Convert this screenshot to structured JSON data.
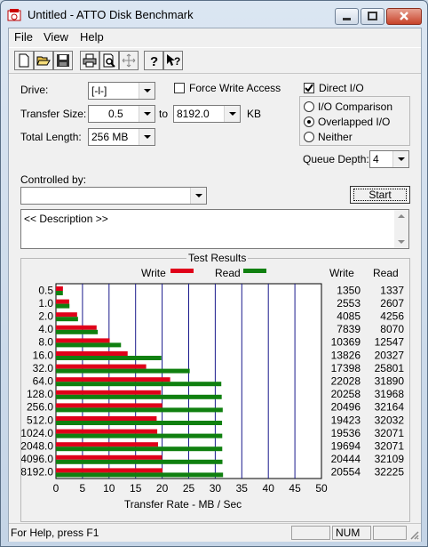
{
  "window": {
    "title": "Untitled - ATTO Disk Benchmark"
  },
  "menu": {
    "file": "File",
    "view": "View",
    "help": "Help"
  },
  "toolbar": {
    "buttons": [
      "new-icon",
      "open-icon",
      "save-icon",
      "print-icon",
      "print-preview-icon",
      "move-icon",
      "help-icon",
      "context-help-icon"
    ]
  },
  "form": {
    "drive_label": "Drive:",
    "drive_value": "[-l-]",
    "force_write_label": "Force Write Access",
    "direct_io_label": "Direct I/O",
    "transfer_size_label": "Transfer Size:",
    "transfer_from": "0.5",
    "to_label": "to",
    "transfer_to": "8192.0",
    "kb_label": "KB",
    "total_length_label": "Total Length:",
    "total_length_value": "256 MB",
    "io_comparison_label": "I/O Comparison",
    "overlapped_io_label": "Overlapped I/O",
    "neither_label": "Neither",
    "queue_depth_label": "Queue Depth:",
    "queue_depth_value": "4",
    "controlled_by_label": "Controlled by:",
    "controlled_by_value": "",
    "start_label": "Start",
    "description": "<< Description >>"
  },
  "results": {
    "group_title": "Test Results",
    "legend_write": "Write",
    "legend_read": "Read",
    "col_write": "Write",
    "col_read": "Read",
    "write_color": "#e0001a",
    "read_color": "#108010",
    "grid_color": "#1a1a8c"
  },
  "chart_data": {
    "type": "bar",
    "orientation": "horizontal",
    "categories": [
      "0.5",
      "1.0",
      "2.0",
      "4.0",
      "8.0",
      "16.0",
      "32.0",
      "64.0",
      "128.0",
      "256.0",
      "512.0",
      "1024.0",
      "2048.0",
      "4096.0",
      "8192.0"
    ],
    "series": [
      {
        "name": "Write",
        "values": [
          1350,
          2553,
          4085,
          7839,
          10369,
          13826,
          17398,
          22028,
          20258,
          20496,
          19423,
          19536,
          19694,
          20444,
          20554
        ]
      },
      {
        "name": "Read",
        "values": [
          1337,
          2607,
          4256,
          8070,
          12547,
          20327,
          25801,
          31890,
          31968,
          32164,
          32032,
          32071,
          32071,
          32109,
          32225
        ]
      }
    ],
    "xlabel": "Transfer Rate - MB / Sec",
    "xlim": [
      0,
      50
    ],
    "xticks": [
      "0",
      "5",
      "10",
      "15",
      "20",
      "25",
      "30",
      "35",
      "40",
      "45",
      "50"
    ],
    "grid": true
  },
  "status": {
    "help_text": "For Help, press F1",
    "num": "NUM"
  }
}
